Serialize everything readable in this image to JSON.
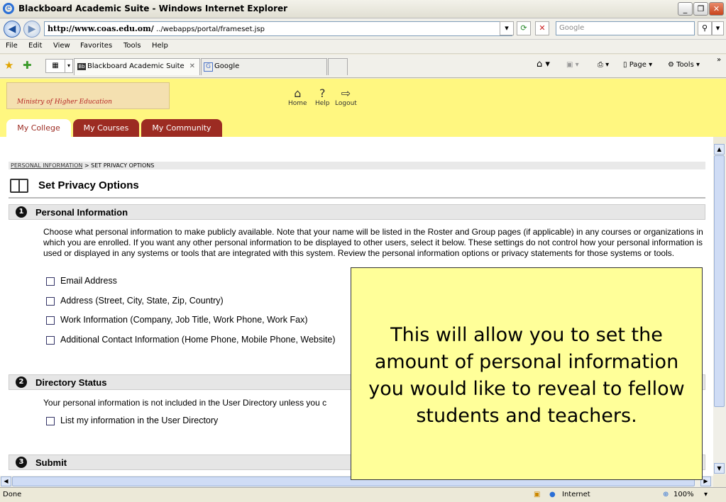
{
  "window": {
    "title": "Blackboard Academic Suite - Windows Internet Explorer"
  },
  "address": {
    "host": "http://www.coas.edu.om/",
    "path": "../webapps/portal/frameset.jsp",
    "search_placeholder": "Google"
  },
  "menu": [
    "File",
    "Edit",
    "View",
    "Favorites",
    "Tools",
    "Help"
  ],
  "browser_tabs": [
    {
      "label": "Blackboard Academic Suite"
    },
    {
      "label": "Google"
    }
  ],
  "toolbar": {
    "page": "Page",
    "tools": "Tools"
  },
  "header": {
    "logo_sub": "Ministry of Higher Education",
    "links": [
      "Home",
      "Help",
      "Logout"
    ],
    "tabs": [
      "My College",
      "My Courses",
      "My Community"
    ]
  },
  "breadcrumb": {
    "parent": "PERSONAL INFORMATION",
    "current": "> SET PRIVACY OPTIONS"
  },
  "page_title": "Set Privacy Options",
  "sections": [
    {
      "num": "1",
      "title": "Personal Information"
    },
    {
      "num": "2",
      "title": "Directory Status"
    },
    {
      "num": "3",
      "title": "Submit"
    }
  ],
  "personal_desc": "Choose what personal information to make publicly available. Note that your name will be listed in the Roster and Group pages (if applicable) in any courses or organizations in which you are enrolled. If you want any other personal information to be displayed to other users, select it below. These settings do not control how your personal information is used or displayed in any systems or tools that are integrated with this system. Review the personal information options or privacy statements for those systems or tools.",
  "personal_options": [
    "Email Address",
    "Address (Street, City, State, Zip, Country)",
    "Work Information (Company, Job Title, Work Phone, Work Fax)",
    "Additional Contact Information (Home Phone, Mobile Phone, Website)"
  ],
  "directory_desc": "Your personal information is not included in the User Directory unless you c",
  "directory_option": "List my information in the User Directory",
  "callout": "This will allow you to set the amount of personal information you would like to reveal to fellow students and teachers.",
  "status": {
    "left": "Done",
    "zone": "Internet",
    "zoom": "100%"
  }
}
